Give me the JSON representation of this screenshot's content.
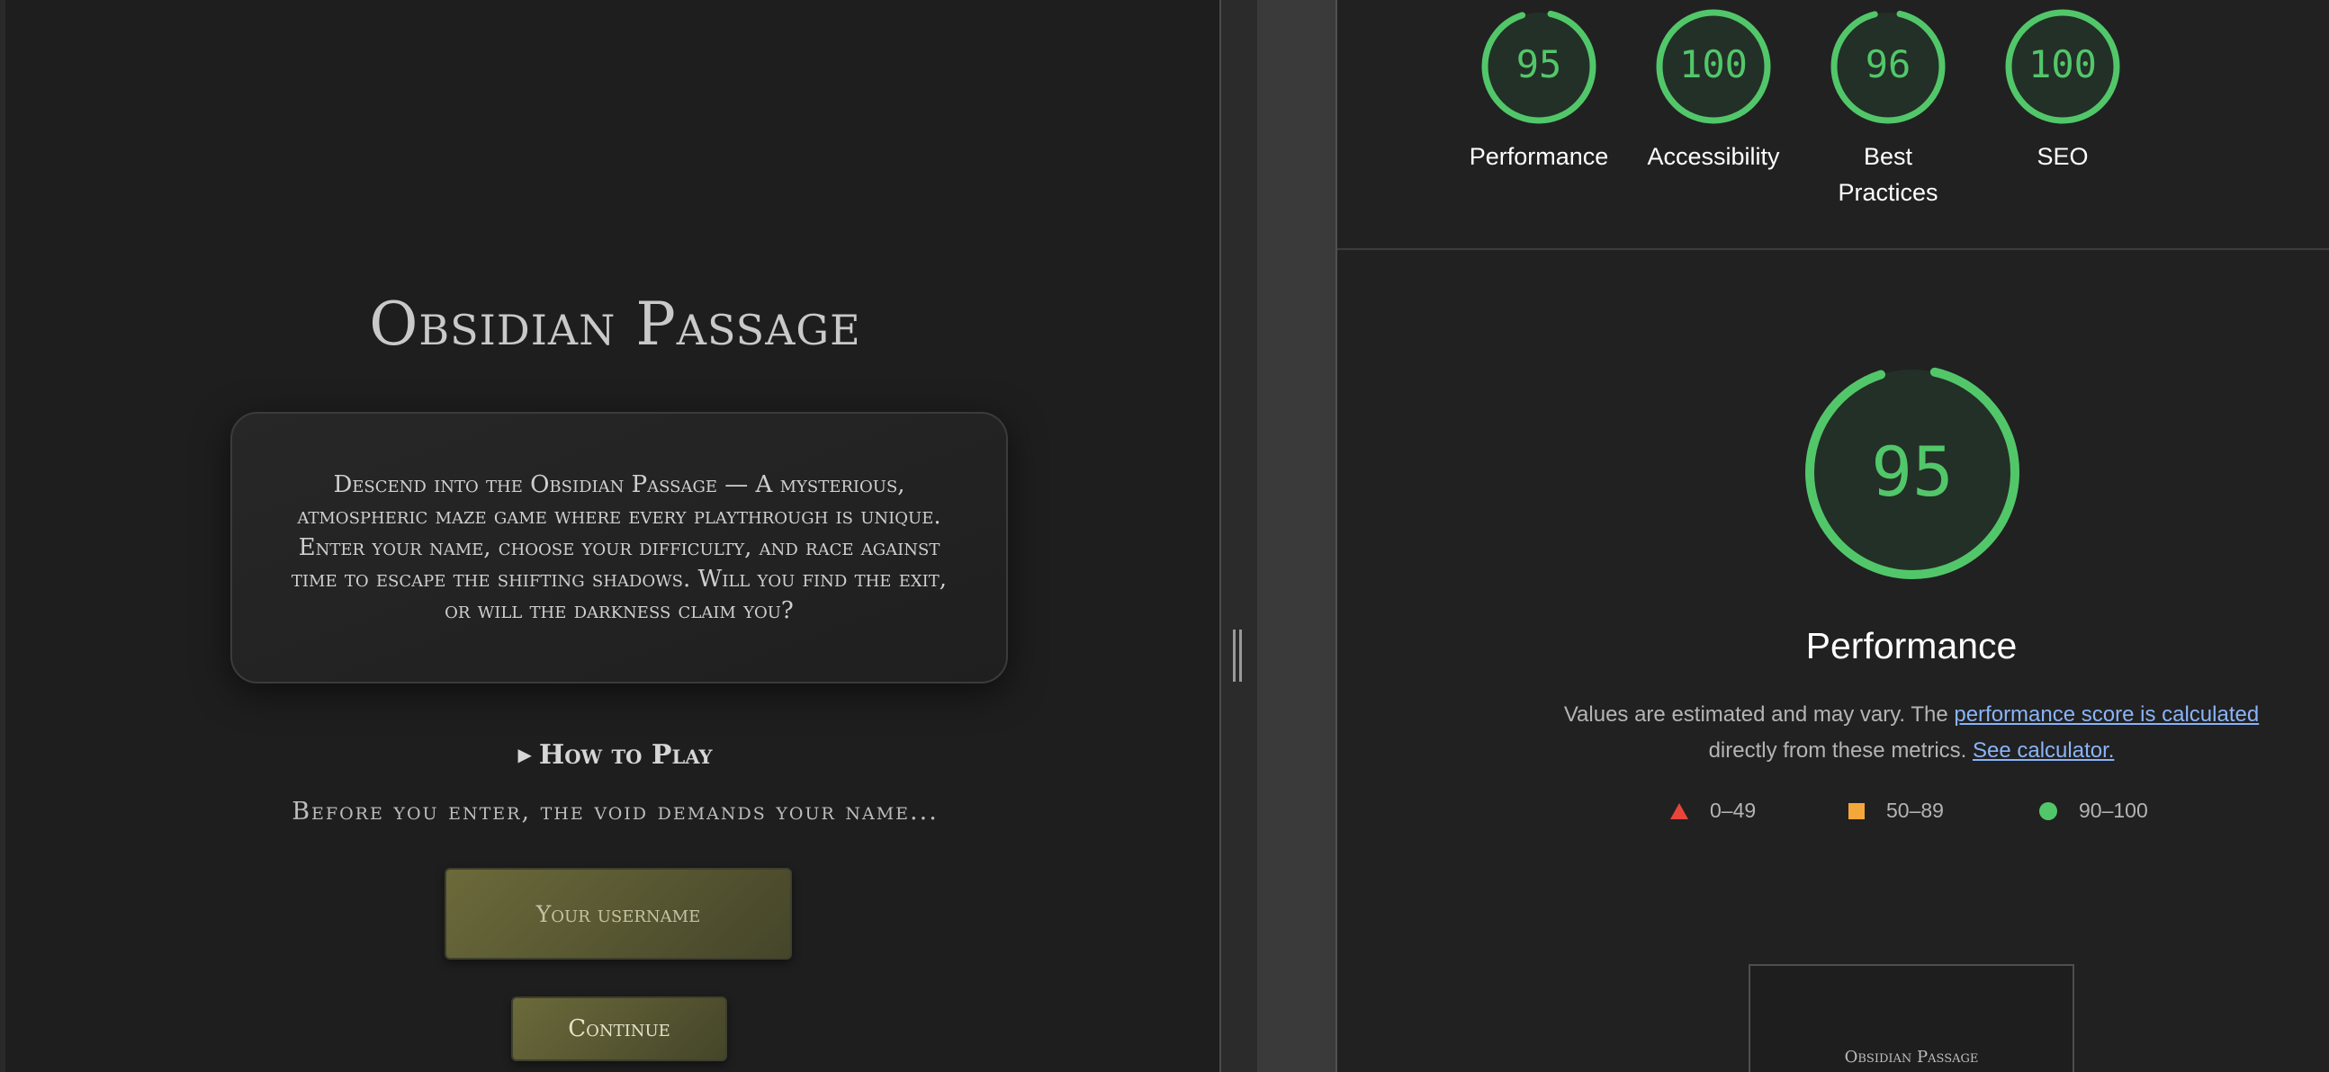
{
  "game": {
    "title": "Obsidian Passage",
    "intro": "Descend into the Obsidian Passage — A mysterious, atmospheric maze game where every playthrough is unique. Enter your name, choose your difficulty, and race against time to escape the shifting shadows. Will you find the exit, or will the darkness claim you?",
    "how_to_play": "How to Play",
    "prompt": "Before you enter, the void demands your name...",
    "username_placeholder": "Your username",
    "continue_label": "Continue"
  },
  "lighthouse": {
    "scores": [
      {
        "label": "Performance",
        "score": "95",
        "value": 95
      },
      {
        "label": "Accessibility",
        "score": "100",
        "value": 100
      },
      {
        "label": "Best Practices",
        "score": "96",
        "value": 96
      },
      {
        "label": "SEO",
        "score": "100",
        "value": 100
      }
    ],
    "performance": {
      "score": "95",
      "value": 95,
      "title": "Performance",
      "desc_prefix": "Values are estimated and may vary. The ",
      "link_score": "performance score is calculated",
      "desc_mid": " directly from these metrics. ",
      "link_calc": "See calculator."
    },
    "legend": {
      "fail": "0–49",
      "average": "50–89",
      "pass": "90–100"
    },
    "thumbnail_title": "Obsidian Passage",
    "colors": {
      "pass": "#52c76a",
      "average": "#f4a83a",
      "fail": "#e8453c",
      "gauge_bg": "#233027"
    }
  }
}
